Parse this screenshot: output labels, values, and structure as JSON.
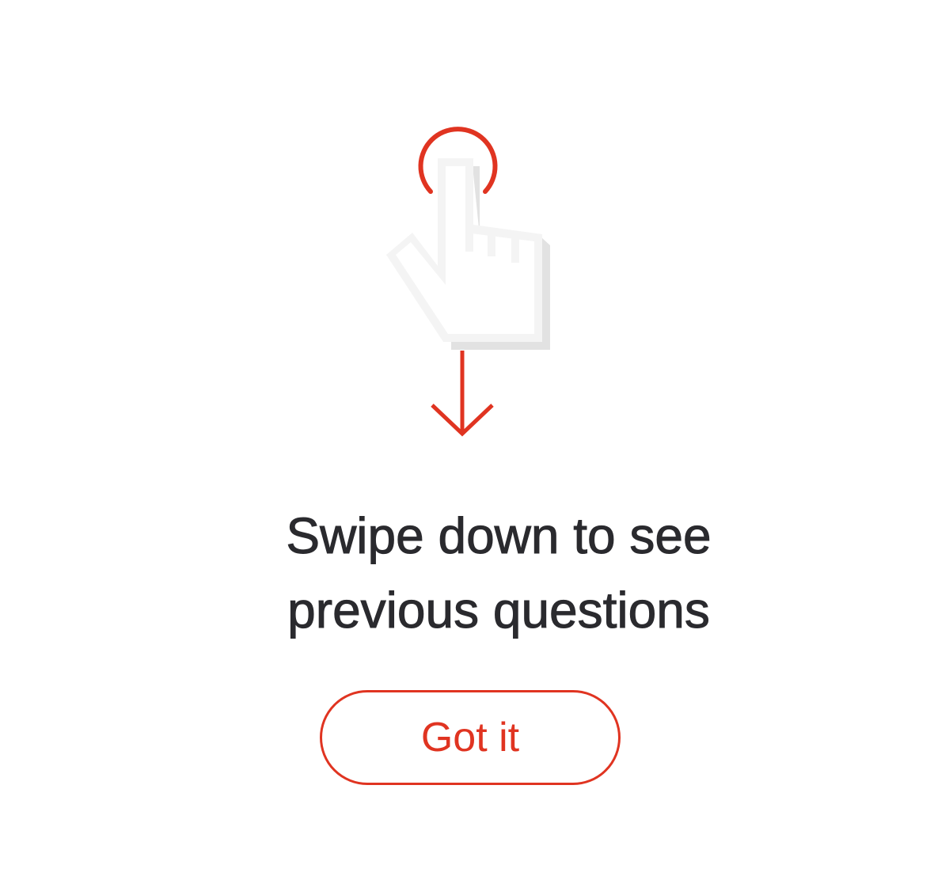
{
  "overlay": {
    "message_line_1": "Swipe down to see",
    "message_line_2": "previous questions",
    "button_label": "Got it"
  },
  "icons": {
    "illustration": "swipe-down-hand-icon",
    "tap": "tap-ring-icon",
    "hand": "pointing-hand-icon",
    "arrow": "arrow-down-icon"
  },
  "colors": {
    "accent": "#e03421",
    "text": "#2a2a2e",
    "background": "#ffffff",
    "hand_fill": "#f4f4f4",
    "hand_shadow": "#e2e2e2"
  }
}
